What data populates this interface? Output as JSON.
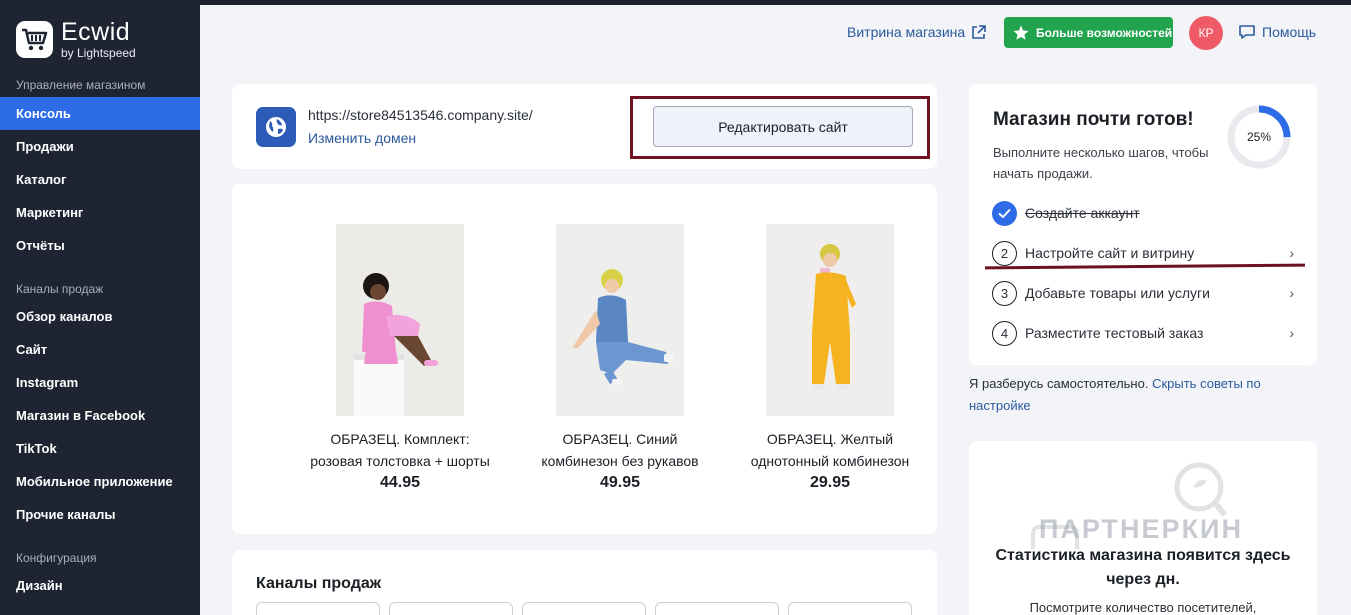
{
  "sidebar": {
    "logo_name": "Ecwid",
    "logo_sub": "by Lightspeed",
    "section_store": "Управление магазином",
    "items_store": [
      "Консоль",
      "Продажи",
      "Каталог",
      "Маркетинг",
      "Отчёты"
    ],
    "section_channels": "Каналы продаж",
    "items_channels": [
      "Обзор каналов",
      "Сайт",
      "Instagram",
      "Магазин в Facebook",
      "TikTok",
      "Мобильное приложение",
      "Прочие каналы"
    ],
    "section_config": "Конфигурация",
    "items_config": [
      "Дизайн"
    ],
    "active_item": "Консоль"
  },
  "header": {
    "storefront_label": "Витрина магазина",
    "more_label": "Больше возможностей",
    "avatar_initials": "КР",
    "help_label": "Помощь"
  },
  "domain": {
    "url": "https://store84513546.company.site/",
    "change_label": "Изменить домен",
    "edit_button": "Редактировать сайт"
  },
  "products": [
    {
      "title_line1": "ОБРАЗЕЦ. Комплект:",
      "title_line2": "розовая толстовка + шорты",
      "price": "44.95"
    },
    {
      "title_line1": "ОБРАЗЕЦ. Синий",
      "title_line2": "комбинезон без рукавов",
      "price": "49.95"
    },
    {
      "title_line1": "ОБРАЗЕЦ. Желтый",
      "title_line2": "однотонный комбинезон",
      "price": "29.95"
    }
  ],
  "channels": {
    "title": "Каналы продаж"
  },
  "ready": {
    "title": "Магазин почти готов!",
    "desc": "Выполните несколько шагов, чтобы начать продажи.",
    "progress_label": "25%",
    "progress_fraction": 0.25,
    "steps": [
      {
        "num": "1",
        "label": "Создайте аккаунт",
        "done": true
      },
      {
        "num": "2",
        "label": "Настройте сайт и витрину",
        "done": false
      },
      {
        "num": "3",
        "label": "Добавьте товары или услуги",
        "done": false
      },
      {
        "num": "4",
        "label": "Разместите тестовый заказ",
        "done": false
      }
    ]
  },
  "hint": {
    "text": "Я разберусь самостоятельно.",
    "link": "Скрыть советы по настройке"
  },
  "stats": {
    "title": "Статистика магазина появится здесь через дн.",
    "sub": "Посмотрите количество посетителей,",
    "watermark": "ПАРТНЕРКИН"
  },
  "colors": {
    "accent": "#2e6be6",
    "sidebar_bg": "#1f2433",
    "success": "#22a34d",
    "highlight": "#6d1020"
  }
}
